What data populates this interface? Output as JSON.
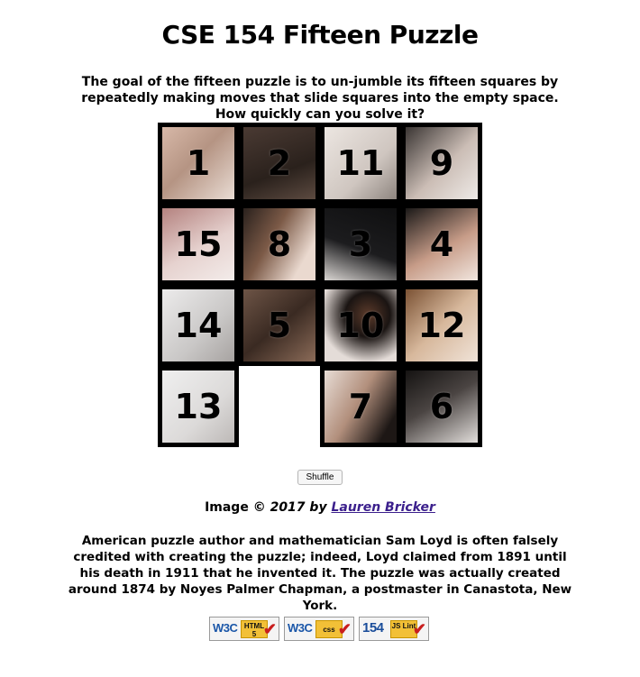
{
  "page": {
    "title": "CSE 154 Fifteen Puzzle",
    "intro": "The goal of the fifteen puzzle is to un-jumble its fifteen squares by repeatedly making moves that slide squares into the empty space. How quickly can you solve it?"
  },
  "puzzle": {
    "grid": [
      [
        "1",
        "2",
        "11",
        "9"
      ],
      [
        "15",
        "8",
        "3",
        "4"
      ],
      [
        "14",
        "5",
        "10",
        "12"
      ],
      [
        "13",
        "",
        "7",
        "6"
      ]
    ],
    "empty_cell": "row 4, column 2"
  },
  "controls": {
    "shuffle_label": "Shuffle"
  },
  "credit": {
    "prefix": "Image ©",
    "year": "2017 by",
    "author": "Lauren Bricker"
  },
  "history": "American puzzle author and mathematician Sam Loyd is often falsely credited with creating the puzzle; indeed, Loyd claimed from 1891 until his death in 1911 that he invented it. The puzzle was actually created around 1874 by Noyes Palmer Chapman, a postmaster in Canastota, New York.",
  "badges": [
    {
      "name": "W3C HTML5 validator",
      "logo": "W3C",
      "tag": "HTML 5"
    },
    {
      "name": "W3C CSS validator",
      "logo": "W3C",
      "tag": "css"
    },
    {
      "name": "154 JSLint",
      "logo": "154",
      "tag": "JS Lint"
    }
  ],
  "colors": {
    "link": "#3b1f8c",
    "tile_border": "#000000"
  }
}
